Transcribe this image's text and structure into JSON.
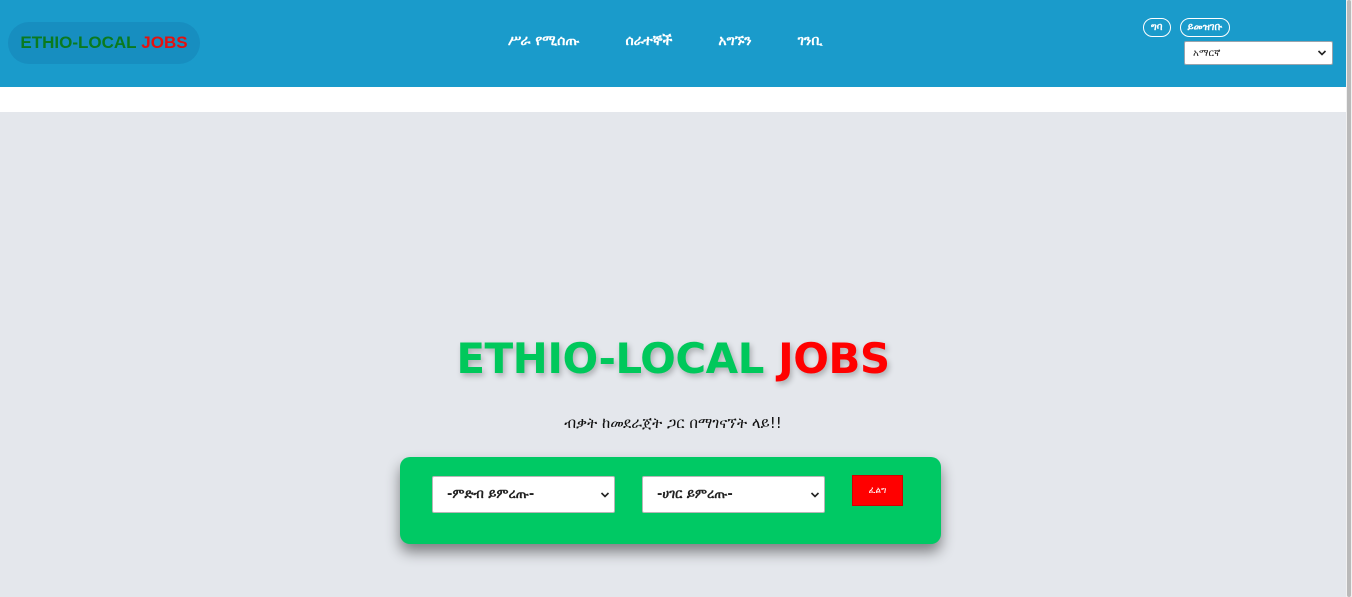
{
  "brand": {
    "part1": "ETHIO-LOCAL",
    "part2": "JOBS"
  },
  "nav": {
    "links": [
      "ሥራ የሚሰጡ",
      "ሰራተኞች",
      "አግኙን",
      "ገንቢ"
    ]
  },
  "auth": {
    "login": "ግባ",
    "register": "ይመዝገቡ"
  },
  "language_select": {
    "selected": "አማርኛ"
  },
  "hero": {
    "title_part1": "ETHIO-LOCAL",
    "title_part2": "JOBS",
    "tagline": "ብቃት ከመደራጀት ጋር በማገናኘት ላይ!!"
  },
  "search": {
    "category_select": "-ምድብ ይምረጡ-",
    "country_select": "-ሀገር ይምረጡ-",
    "button": "ፈልግ"
  },
  "colors": {
    "navbar": "#1a9bcb",
    "brand_green": "#00c85b",
    "brand_red": "#ff0000",
    "search_panel": "#00c964"
  },
  "icons": [
    "chevron-down-icon"
  ]
}
